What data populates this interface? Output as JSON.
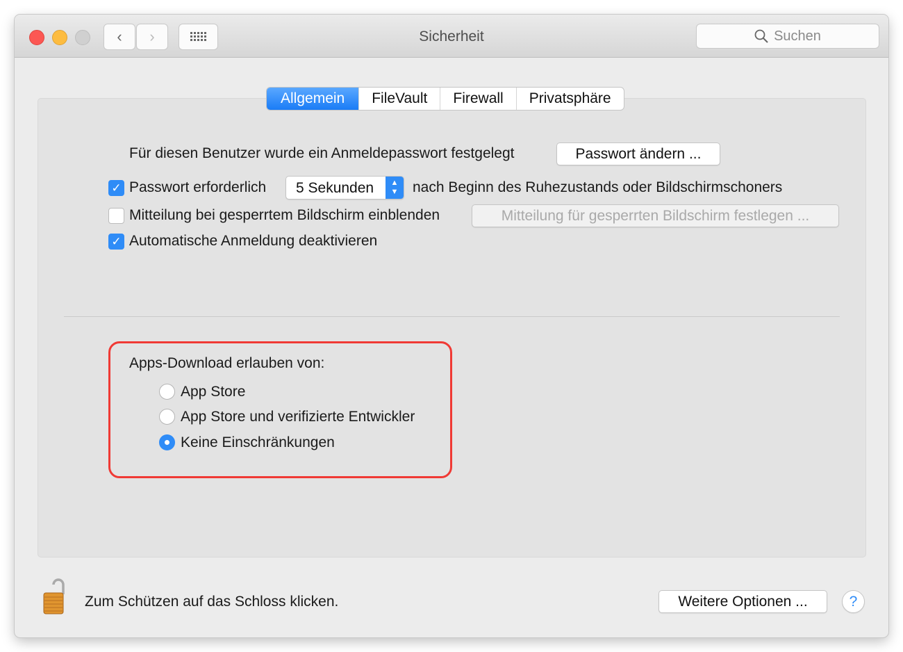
{
  "window": {
    "title": "Sicherheit",
    "search_placeholder": "Suchen"
  },
  "tabs": [
    {
      "label": "Allgemein",
      "active": true
    },
    {
      "label": "FileVault"
    },
    {
      "label": "Firewall"
    },
    {
      "label": "Privatsphäre"
    }
  ],
  "general": {
    "password_set_text": "Für diesen Benutzer wurde ein Anmeldepasswort festgelegt",
    "change_password_button": "Passwort ändern ...",
    "require_password": {
      "label": "Passwort erforderlich",
      "checked": true,
      "delay": "5 Sekunden",
      "suffix": "nach Beginn des Ruhezustands oder Bildschirmschoners"
    },
    "lock_message": {
      "label": "Mitteilung bei gesperrtem Bildschirm einblenden",
      "checked": false,
      "button": "Mitteilung für gesperrten Bildschirm festlegen ..."
    },
    "disable_auto_login": {
      "label": "Automatische Anmeldung deaktivieren",
      "checked": true
    }
  },
  "downloads": {
    "heading": "Apps-Download erlauben von:",
    "options": [
      "App Store",
      "App Store und verifizierte Entwickler",
      "Keine Einschränkungen"
    ],
    "selected": 2,
    "highlight_color": "#f03a35"
  },
  "footer": {
    "lock_text": "Zum Schützen auf das Schloss klicken.",
    "more_options": "Weitere Optionen ...",
    "help": "?"
  },
  "colors": {
    "accent": "#2f8cf7",
    "close": "#fc5753",
    "minimize": "#fdbc40",
    "zoom_disabled": "#d0d0d0"
  }
}
